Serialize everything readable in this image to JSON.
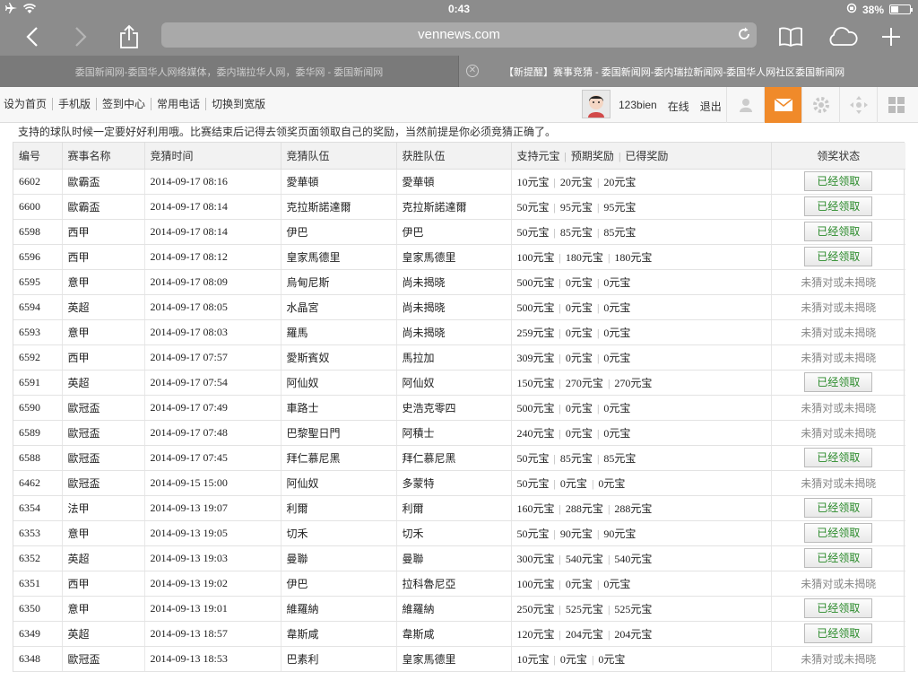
{
  "status_bar": {
    "time": "0:43",
    "battery": "38%",
    "battery_level": 0.38
  },
  "browser": {
    "url": "vennews.com",
    "tabs": [
      {
        "title": "委国新闻网-委国华人网络媒体，委内瑞拉华人网，委华网 - 委国新闻网",
        "active": false
      },
      {
        "title": "【新提醒】赛事竞猜 - 委国新闻网-委内瑞拉新闻网-委国华人网社区委国新闻网",
        "active": true
      }
    ]
  },
  "site": {
    "links": [
      "设为首页",
      "手机版",
      "签到中心",
      "常用电话",
      "切换到宽版"
    ],
    "username": "123bien",
    "online": "在线",
    "logout": "退出"
  },
  "notice": "支持的球队时候一定要好好利用哦。比赛结束后记得去领奖页面领取自己的奖励，当然前提是你必须竞猜正确了。",
  "table": {
    "headers": {
      "id": "编号",
      "league": "赛事名称",
      "time": "竞猜时间",
      "team": "竞猜队伍",
      "winner": "获胜队伍",
      "support": "支持元宝",
      "expected": "预期奖励",
      "got": "已得奖励",
      "status": "领奖状态"
    },
    "claimed_label": "已经领取",
    "unclaimed_label": "未猜对或未揭晓",
    "rows": [
      {
        "id": "6602",
        "league": "歐霸盃",
        "time": "2014-09-17 08:16",
        "team": "愛華頓",
        "winner": "愛華頓",
        "support": "10元宝",
        "expected": "20元宝",
        "got": "20元宝",
        "claimed": true
      },
      {
        "id": "6600",
        "league": "歐霸盃",
        "time": "2014-09-17 08:14",
        "team": "克拉斯諾達爾",
        "winner": "克拉斯諾達爾",
        "support": "50元宝",
        "expected": "95元宝",
        "got": "95元宝",
        "claimed": true
      },
      {
        "id": "6598",
        "league": "西甲",
        "time": "2014-09-17 08:14",
        "team": "伊巴",
        "winner": "伊巴",
        "support": "50元宝",
        "expected": "85元宝",
        "got": "85元宝",
        "claimed": true
      },
      {
        "id": "6596",
        "league": "西甲",
        "time": "2014-09-17 08:12",
        "team": "皇家馬德里",
        "winner": "皇家馬德里",
        "support": "100元宝",
        "expected": "180元宝",
        "got": "180元宝",
        "claimed": true
      },
      {
        "id": "6595",
        "league": "意甲",
        "time": "2014-09-17 08:09",
        "team": "烏甸尼斯",
        "winner": "尚未揭晓",
        "support": "500元宝",
        "expected": "0元宝",
        "got": "0元宝",
        "claimed": false
      },
      {
        "id": "6594",
        "league": "英超",
        "time": "2014-09-17 08:05",
        "team": "水晶宮",
        "winner": "尚未揭晓",
        "support": "500元宝",
        "expected": "0元宝",
        "got": "0元宝",
        "claimed": false
      },
      {
        "id": "6593",
        "league": "意甲",
        "time": "2014-09-17 08:03",
        "team": "羅馬",
        "winner": "尚未揭晓",
        "support": "259元宝",
        "expected": "0元宝",
        "got": "0元宝",
        "claimed": false
      },
      {
        "id": "6592",
        "league": "西甲",
        "time": "2014-09-17 07:57",
        "team": "愛斯賓奴",
        "winner": "馬拉加",
        "support": "309元宝",
        "expected": "0元宝",
        "got": "0元宝",
        "claimed": false
      },
      {
        "id": "6591",
        "league": "英超",
        "time": "2014-09-17 07:54",
        "team": "阿仙奴",
        "winner": "阿仙奴",
        "support": "150元宝",
        "expected": "270元宝",
        "got": "270元宝",
        "claimed": true
      },
      {
        "id": "6590",
        "league": "歐冠盃",
        "time": "2014-09-17 07:49",
        "team": "車路士",
        "winner": "史浩克零四",
        "support": "500元宝",
        "expected": "0元宝",
        "got": "0元宝",
        "claimed": false
      },
      {
        "id": "6589",
        "league": "歐冠盃",
        "time": "2014-09-17 07:48",
        "team": "巴黎聖日門",
        "winner": "阿積士",
        "support": "240元宝",
        "expected": "0元宝",
        "got": "0元宝",
        "claimed": false
      },
      {
        "id": "6588",
        "league": "歐冠盃",
        "time": "2014-09-17 07:45",
        "team": "拜仁慕尼黑",
        "winner": "拜仁慕尼黑",
        "support": "50元宝",
        "expected": "85元宝",
        "got": "85元宝",
        "claimed": true
      },
      {
        "id": "6462",
        "league": "歐冠盃",
        "time": "2014-09-15 15:00",
        "team": "阿仙奴",
        "winner": "多蒙特",
        "support": "50元宝",
        "expected": "0元宝",
        "got": "0元宝",
        "claimed": false
      },
      {
        "id": "6354",
        "league": "法甲",
        "time": "2014-09-13 19:07",
        "team": "利爾",
        "winner": "利爾",
        "support": "160元宝",
        "expected": "288元宝",
        "got": "288元宝",
        "claimed": true
      },
      {
        "id": "6353",
        "league": "意甲",
        "time": "2014-09-13 19:05",
        "team": "切禾",
        "winner": "切禾",
        "support": "50元宝",
        "expected": "90元宝",
        "got": "90元宝",
        "claimed": true
      },
      {
        "id": "6352",
        "league": "英超",
        "time": "2014-09-13 19:03",
        "team": "曼聯",
        "winner": "曼聯",
        "support": "300元宝",
        "expected": "540元宝",
        "got": "540元宝",
        "claimed": true
      },
      {
        "id": "6351",
        "league": "西甲",
        "time": "2014-09-13 19:02",
        "team": "伊巴",
        "winner": "拉科魯尼亞",
        "support": "100元宝",
        "expected": "0元宝",
        "got": "0元宝",
        "claimed": false
      },
      {
        "id": "6350",
        "league": "意甲",
        "time": "2014-09-13 19:01",
        "team": "維羅納",
        "winner": "維羅納",
        "support": "250元宝",
        "expected": "525元宝",
        "got": "525元宝",
        "claimed": true
      },
      {
        "id": "6349",
        "league": "英超",
        "time": "2014-09-13 18:57",
        "team": "韋斯咸",
        "winner": "韋斯咸",
        "support": "120元宝",
        "expected": "204元宝",
        "got": "204元宝",
        "claimed": true
      },
      {
        "id": "6348",
        "league": "歐冠盃",
        "time": "2014-09-13 18:53",
        "team": "巴素利",
        "winner": "皇家馬德里",
        "support": "10元宝",
        "expected": "0元宝",
        "got": "0元宝",
        "claimed": false
      }
    ]
  }
}
